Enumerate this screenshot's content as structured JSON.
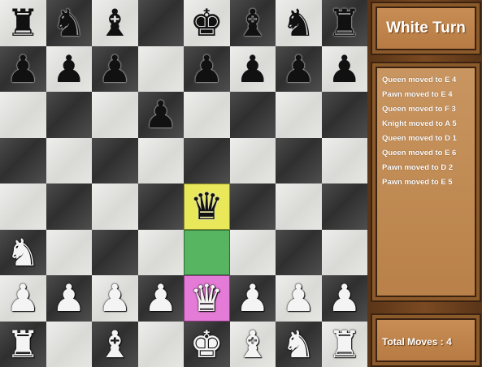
{
  "game": {
    "turn_label": "White Turn",
    "total_moves_label": "Total Moves : 4"
  },
  "move_log": [
    "Queen moved to E 4",
    "Pawn moved to E 4",
    "Queen moved to F 3",
    "Knight moved to A 5",
    "Queen moved to D 1",
    "Queen moved to E 6",
    "Pawn moved to D 2",
    "Pawn moved to E 5"
  ],
  "board": {
    "rows": [
      [
        "r",
        "n",
        "b",
        "",
        "k",
        "b",
        "n",
        "r"
      ],
      [
        "p",
        "p",
        "p",
        "",
        "p",
        "p",
        "p",
        "p"
      ],
      [
        "",
        "",
        "",
        "p",
        "",
        "",
        "",
        ""
      ],
      [
        "",
        "",
        "",
        "",
        "",
        "",
        "",
        ""
      ],
      [
        "",
        "",
        "",
        "",
        "q",
        "",
        "",
        ""
      ],
      [
        "N",
        "",
        "",
        "",
        "",
        "",
        "",
        ""
      ],
      [
        "P",
        "P",
        "P",
        "P",
        "Q",
        "P",
        "P",
        "P"
      ],
      [
        "R",
        "",
        "B",
        "",
        "K",
        "B",
        "N",
        "R"
      ]
    ],
    "highlights": [
      {
        "row": 4,
        "col": 4,
        "color": "yellow"
      },
      {
        "row": 5,
        "col": 4,
        "color": "green"
      },
      {
        "row": 6,
        "col": 4,
        "color": "pink"
      }
    ]
  },
  "colors": {
    "highlight_yellow": "#e8e85a",
    "highlight_green": "#57b561",
    "highlight_pink": "#e47bd6",
    "panel_wood": "#c88e56",
    "frame_wood": "#5a3518"
  }
}
